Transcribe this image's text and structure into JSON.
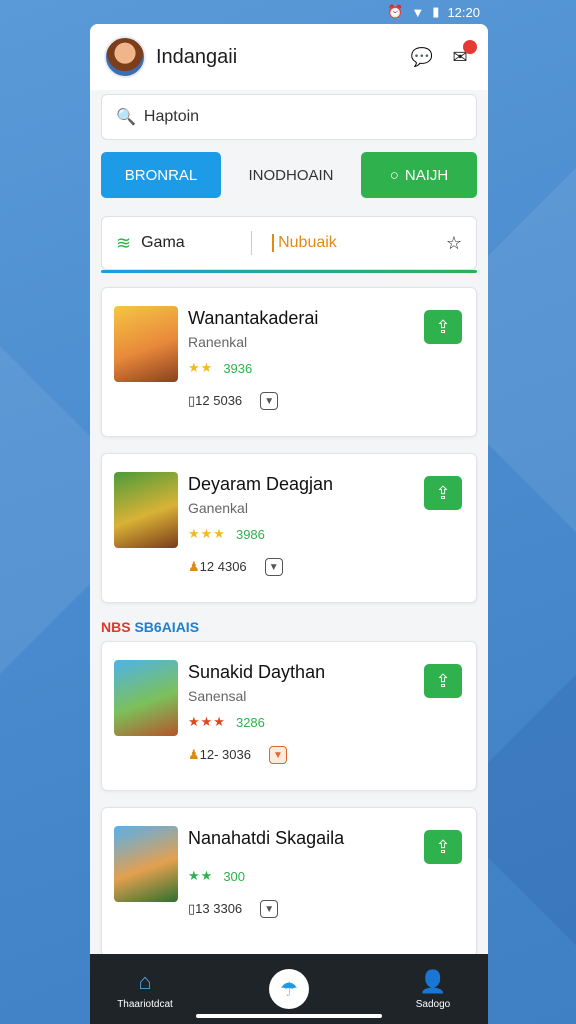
{
  "status": {
    "time": "12:20",
    "alarm_icon": "alarm-icon",
    "wifi_icon": "wifi-icon",
    "battery_icon": "battery-icon"
  },
  "header": {
    "title": "Indangaii",
    "notification_count": ""
  },
  "search": {
    "placeholder": "Haptoin"
  },
  "buttons": {
    "left": "BRONRAL",
    "middle": "INODHOAIN",
    "right": "NAIJH"
  },
  "filter": {
    "label1": "Gama",
    "label2": "Nubuaik"
  },
  "games": [
    {
      "title": "Wanantakaderai",
      "subtitle": "Ranenkal",
      "rating": "3936",
      "size": "12 5036",
      "stars": "★★"
    },
    {
      "title": "Deyaram Deagjan",
      "subtitle": "Ganenkal",
      "rating": "3986",
      "size": "12 4306",
      "stars": "★★★"
    }
  ],
  "section": {
    "part1": "NBS",
    "part2": "SB6AIAIS"
  },
  "games2": [
    {
      "title": "Sunakid Daythan",
      "subtitle": "Sanensal",
      "rating": "3286",
      "size": "12- 3036",
      "stars": "★★★"
    },
    {
      "title": "Nanahatdi Skagaila",
      "subtitle": "",
      "rating": "300",
      "size": "13 3306",
      "stars": "★★"
    }
  ],
  "bottomnav": {
    "left_label": "Thaariotdcat",
    "right_label": "Sadogo"
  }
}
